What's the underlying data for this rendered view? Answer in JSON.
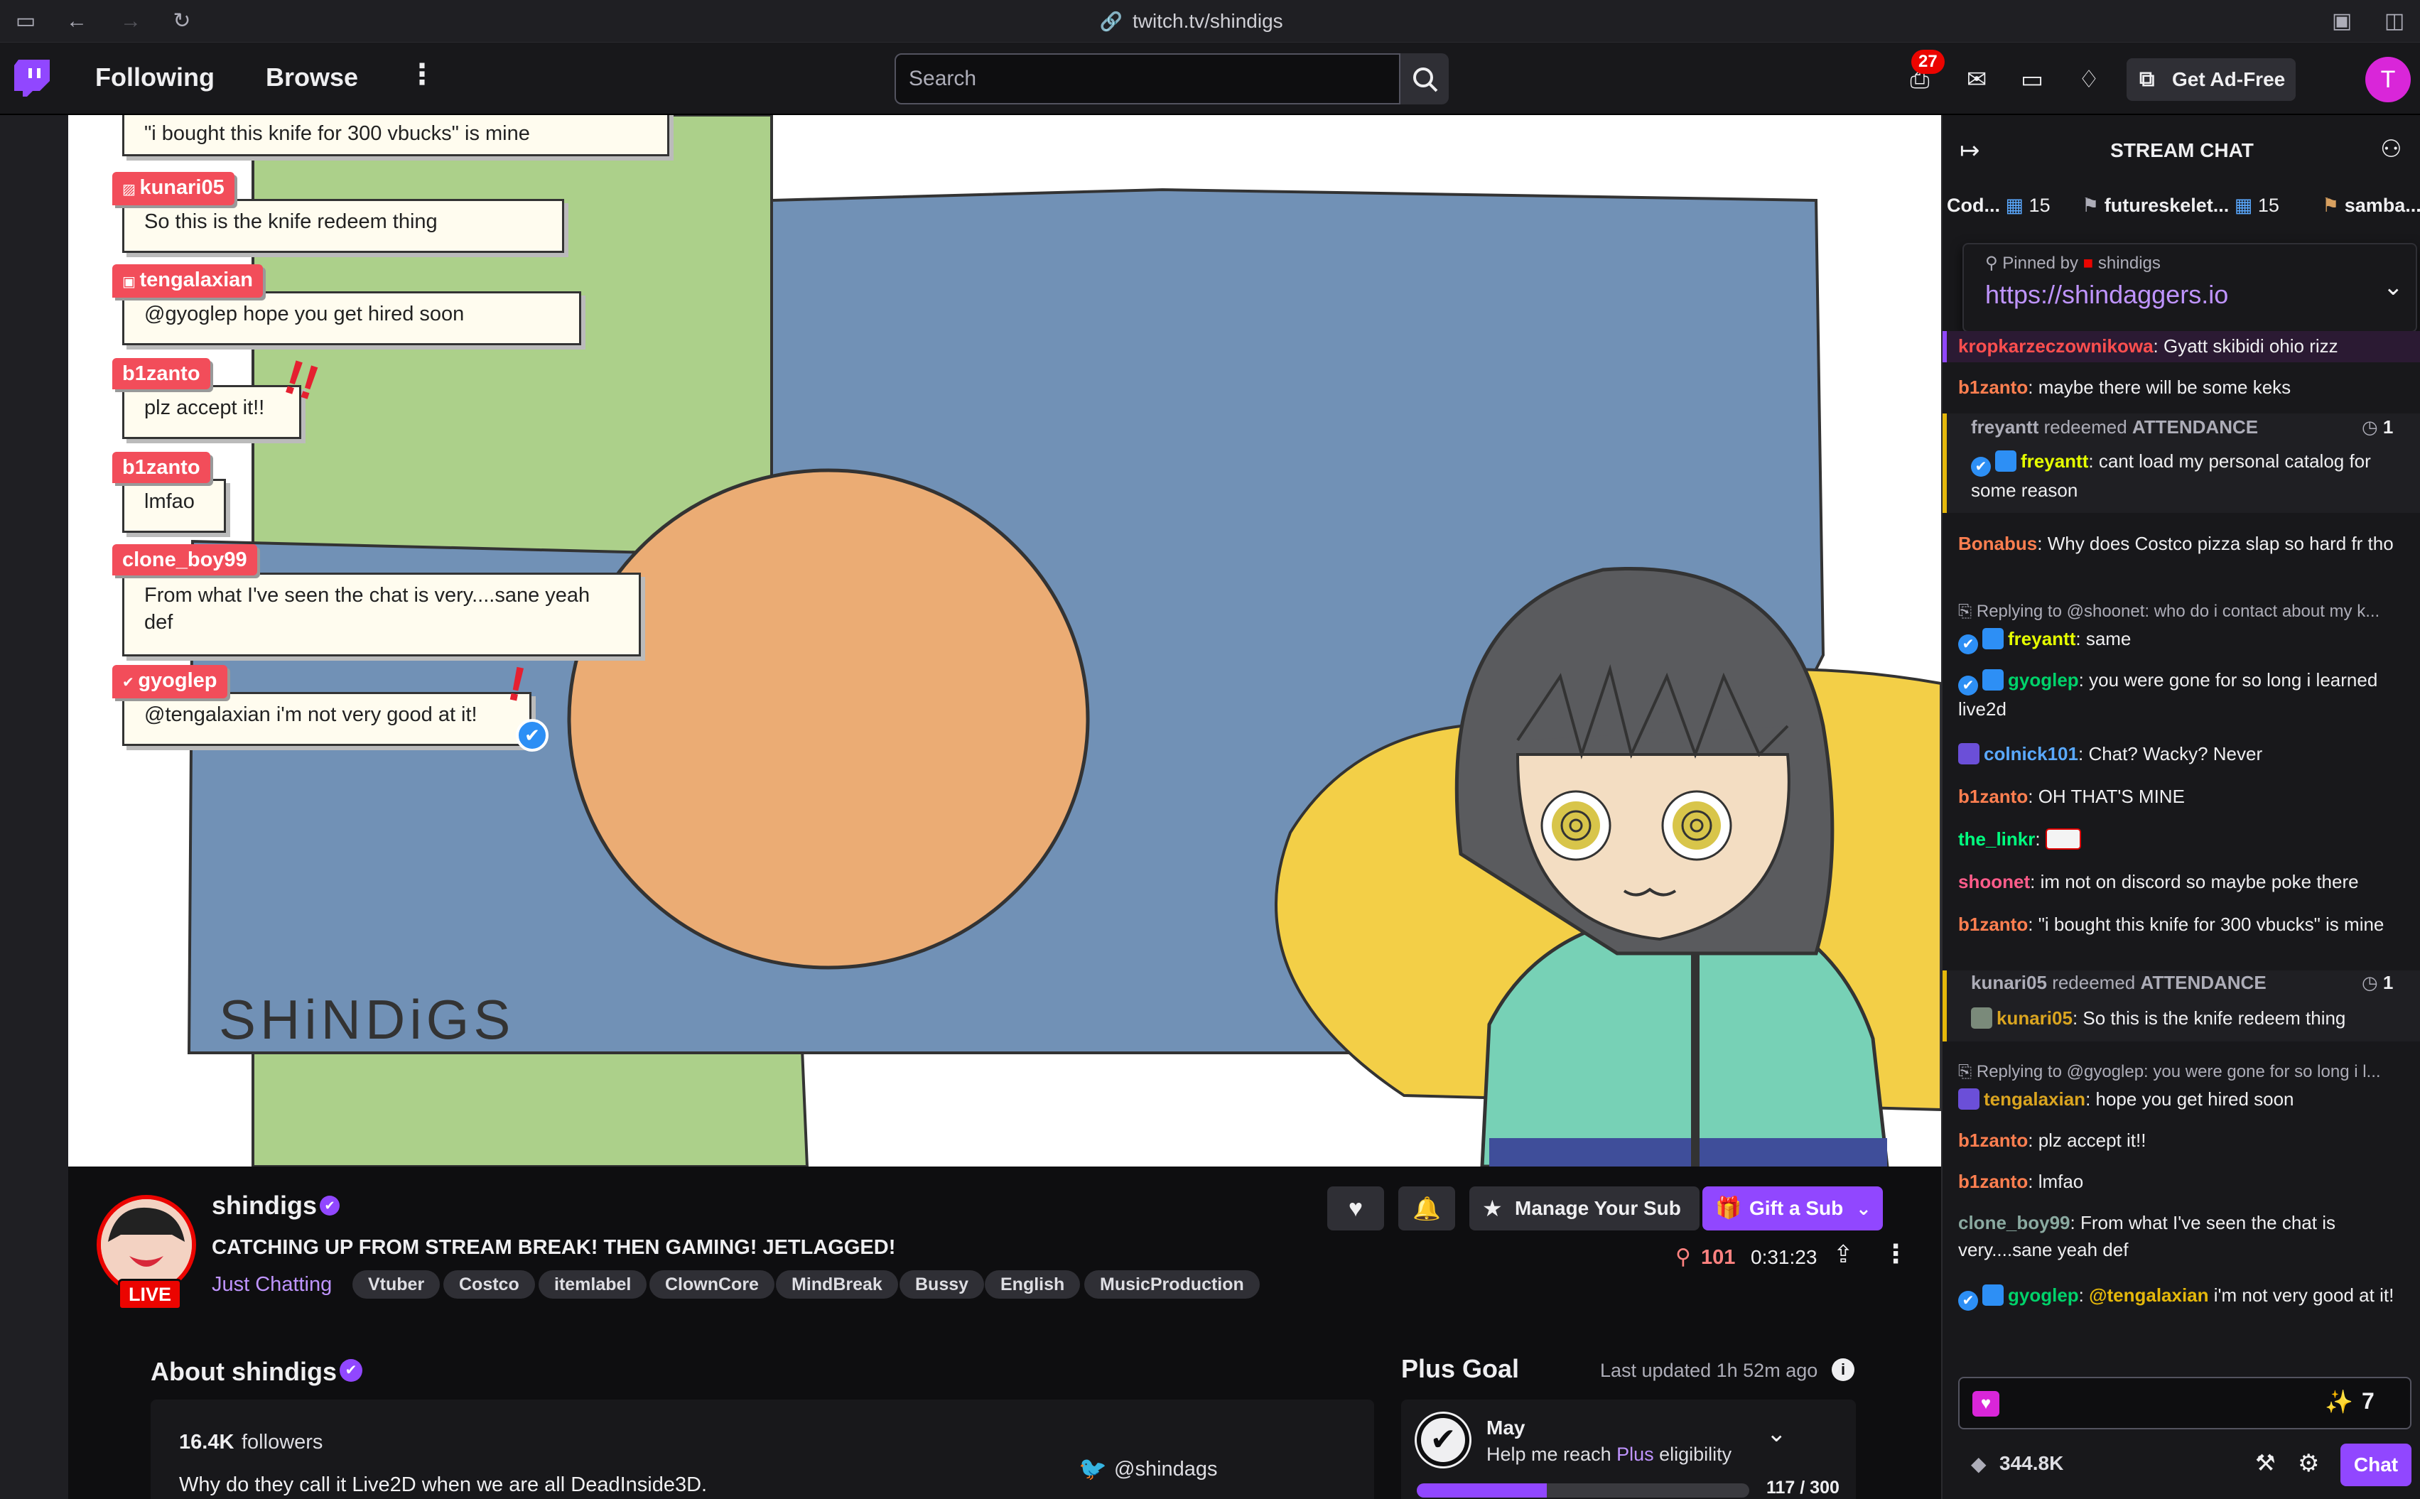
{
  "browser": {
    "url": "twitch.tv/shindigs"
  },
  "nav": {
    "following": "Following",
    "browse": "Browse",
    "search_placeholder": "Search",
    "notifications_count": "27",
    "get_ad_free": "Get Ad-Free",
    "avatar_letter": "T"
  },
  "overlay": {
    "messages": [
      {
        "user": "",
        "text": "\"i bought this knife for 300 vbucks\" is mine"
      },
      {
        "user": "kunari05",
        "text": "So this is the knife redeem thing"
      },
      {
        "user": "tengalaxian",
        "text": "@gyoglep hope you get hired soon"
      },
      {
        "user": "b1zanto",
        "text": "plz accept it!!"
      },
      {
        "user": "b1zanto",
        "text": "lmfao"
      },
      {
        "user": "clone_boy99",
        "text": "From what I've seen the chat is very....sane yeah def"
      },
      {
        "user": "gyoglep",
        "text": "@tengalaxian i'm not very good at it!"
      }
    ],
    "signature": "SHiNDiGS"
  },
  "stream": {
    "channel": "shindigs",
    "live": "LIVE",
    "title": "CATCHING UP FROM STREAM BREAK! THEN GAMING! JETLAGGED!",
    "category": "Just Chatting",
    "tags": [
      "Vtuber",
      "Costco",
      "itemlabel",
      "ClownCore",
      "MindBreak",
      "Bussy",
      "English",
      "MusicProduction"
    ],
    "viewers": "101",
    "uptime": "0:31:23",
    "manage_sub": "Manage Your Sub",
    "gift_sub": "Gift a Sub"
  },
  "about": {
    "heading": "About shindigs",
    "followers_count": "16.4K",
    "followers_label": "followers",
    "bio": "Why do they call it Live2D when we are all DeadInside3D.",
    "twitter": "@shindags"
  },
  "plus_goal": {
    "heading": "Plus Goal",
    "updated": "Last updated 1h 52m ago",
    "month": "May",
    "desc_prefix": "Help me reach ",
    "desc_plus": "Plus",
    "desc_suffix": " eligibility",
    "progress_text": "117 / 300",
    "progress_value": 117,
    "progress_max": 300
  },
  "chat": {
    "header": "STREAM CHAT",
    "leaderboard": [
      {
        "name": "Cod...",
        "count": "15"
      },
      {
        "name": "futureskelet...",
        "count": "15"
      },
      {
        "name": "samba...",
        "count": ""
      }
    ],
    "pinned_by_label": "Pinned by",
    "pinned_by_user": "shindigs",
    "pinned_link": "https://shindaggers.io",
    "points": "344.8K",
    "chat_button": "Chat",
    "messages": [
      {
        "user": "kropkarzeczownikowa",
        "color": "#ff4f4f",
        "text": "Gyatt skibidi ohio rizz"
      },
      {
        "user": "b1zanto",
        "color": "#ff7f50",
        "text": "maybe there will be some keks"
      },
      {
        "redeem_user": "freyantt",
        "redeem_word": "redeemed",
        "reward": "ATTENDANCE",
        "count": "1",
        "user": "freyantt",
        "color": "#e6ff00",
        "text": "cant load my personal catalog for some reason"
      },
      {
        "user": "Bonabus",
        "color": "#ff7f50",
        "text": "Why does Costco pizza slap so hard fr tho"
      },
      {
        "reply_to": "Replying to @shoonet: who do i contact about my k...",
        "user": "freyantt",
        "color": "#e6ff00",
        "text": "same"
      },
      {
        "user": "gyoglep",
        "color": "#00d26a",
        "text": "you were gone for so long i learned live2d"
      },
      {
        "user": "colnick101",
        "color": "#5aa9ff",
        "text": "Chat? Wacky? Never"
      },
      {
        "user": "b1zanto",
        "color": "#ff7f50",
        "text": "OH THAT'S MINE"
      },
      {
        "user": "the_linkr",
        "color": "#00ff7f",
        "text": ""
      },
      {
        "user": "shoonet",
        "color": "#ff5c8a",
        "text": "im not on discord so maybe poke there"
      },
      {
        "user": "b1zanto",
        "color": "#ff7f50",
        "text": "\"i bought this knife for 300 vbucks\" is mine"
      },
      {
        "redeem_user": "kunari05",
        "redeem_word": "redeemed",
        "reward": "ATTENDANCE",
        "count": "1",
        "user": "kunari05",
        "color": "#daa520",
        "text": "So this is the knife redeem thing"
      },
      {
        "reply_to": "Replying to @gyoglep: you were gone for so long i l...",
        "user": "tengalaxian",
        "color": "#daa520",
        "text": "hope you get hired soon"
      },
      {
        "user": "b1zanto",
        "color": "#ff7f50",
        "text": "plz accept it!!"
      },
      {
        "user": "b1zanto",
        "color": "#ff7f50",
        "text": "lmfao"
      },
      {
        "user": "clone_boy99",
        "color": "#8aa9a0",
        "text": "From what I've seen the chat is very....sane yeah def"
      },
      {
        "user": "gyoglep",
        "color": "#00d26a",
        "mention": "@tengalaxian",
        "text": "i'm not very good at it!"
      }
    ]
  },
  "colors": {
    "brand": "#9147ff",
    "live": "#eb0400",
    "bg": "#0e0e10",
    "chat_bg": "#18181b"
  }
}
